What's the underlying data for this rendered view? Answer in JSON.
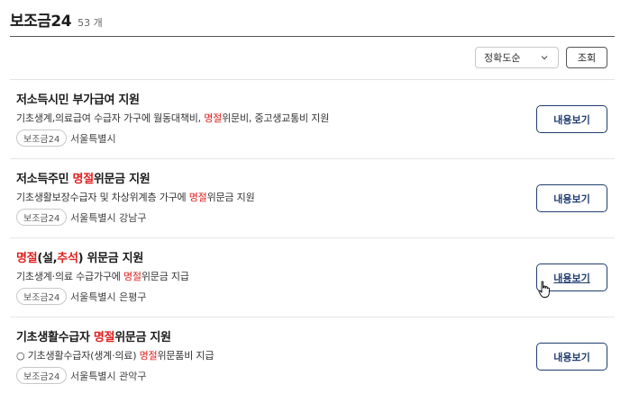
{
  "header": {
    "title": "보조금24",
    "count": "53 개"
  },
  "toolbar": {
    "sort_value": "정확도순",
    "search_label": "조회"
  },
  "items": [
    {
      "title_parts": [
        "저소득시민 부가급여 지원",
        "",
        ""
      ],
      "desc_parts": [
        "기초생계,의료급여 수급자 가구에 월동대책비, ",
        "명절",
        "위문비, 중고생교통비 지원"
      ],
      "tag": "보조금24",
      "region": "서울특별시",
      "button": "내용보기"
    },
    {
      "title_parts": [
        "저소득주민 ",
        "명절",
        "위문금 지원"
      ],
      "desc_parts": [
        "기초생활보장수급자 및 차상위계층 가구에 ",
        "명절",
        "위문금 지원"
      ],
      "tag": "보조금24",
      "region": "서울특별시 강남구",
      "button": "내용보기"
    },
    {
      "title_parts": [
        "",
        "명절",
        "(설,",
        "추석",
        ") 위문금 지원"
      ],
      "desc_parts": [
        "기초생계·의료 수급가구에 ",
        "명절",
        "위문금 지급"
      ],
      "tag": "보조금24",
      "region": "서울특별시 은평구",
      "button": "내용보기"
    },
    {
      "title_parts": [
        "기초생활수급자 ",
        "명절",
        "위문금 지원"
      ],
      "desc_parts": [
        "○ 기초생활수급자(생계·의료) ",
        "명절",
        "위문품비 지급"
      ],
      "tag": "보조금24",
      "region": "서울특별시 관악구",
      "button": "내용보기"
    }
  ],
  "colors": {
    "highlight": "#e0211f",
    "button_border": "#1f3d6f"
  },
  "icons": {
    "sort_chevron": "chevron-down-icon",
    "cursor": "hand-pointer-icon"
  }
}
